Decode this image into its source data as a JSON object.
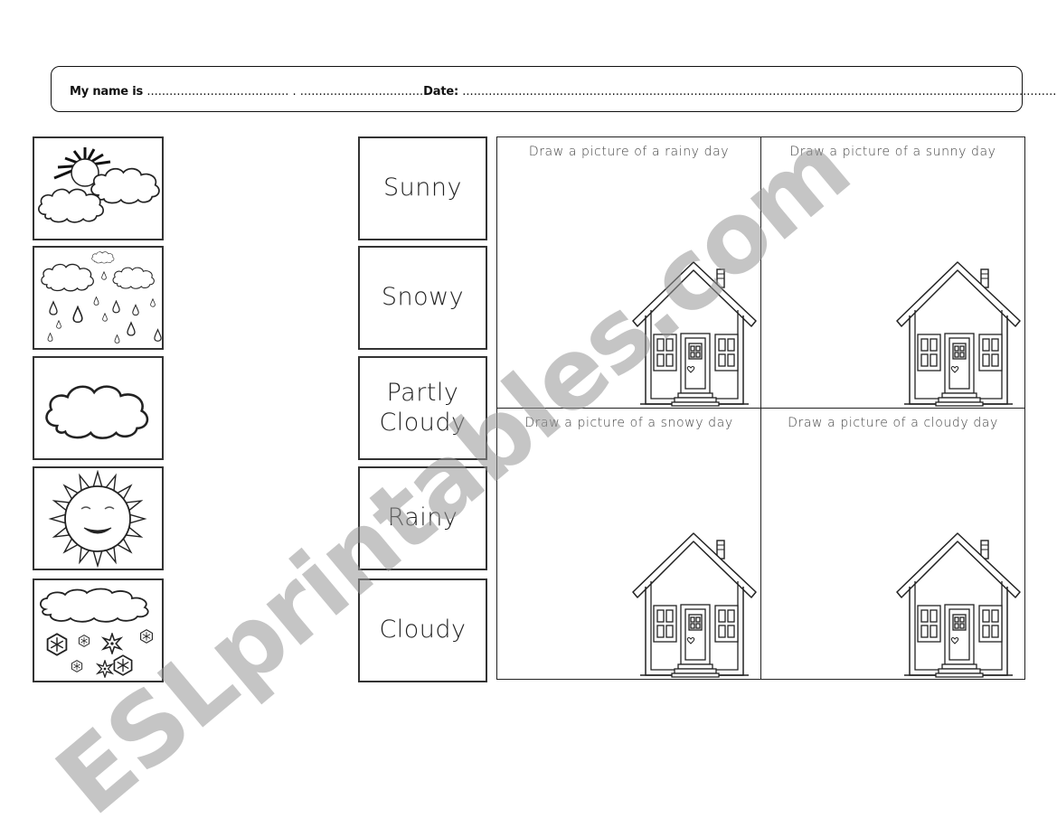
{
  "header": {
    "name_label": "My name is",
    "name_dots": "...................................... . .................................",
    "date_label": "Date",
    "date_colon": ":",
    "date_dots": "........................................................................................................................................................................................"
  },
  "pictures": [
    {
      "name": "partly-cloudy-picture",
      "icon": "sun-behind-clouds-icon"
    },
    {
      "name": "rainy-picture",
      "icon": "rain-clouds-icon"
    },
    {
      "name": "cloudy-picture",
      "icon": "cloud-icon"
    },
    {
      "name": "sunny-picture",
      "icon": "smiling-sun-icon"
    },
    {
      "name": "snowy-picture",
      "icon": "snow-cloud-icon"
    }
  ],
  "words": [
    {
      "label": "Sunny"
    },
    {
      "label": "Snowy"
    },
    {
      "label": "Partly Cloudy"
    },
    {
      "label": "Rainy"
    },
    {
      "label": "Cloudy"
    }
  ],
  "drawing_cells": [
    {
      "title": "Draw a picture of a rainy day"
    },
    {
      "title": "Draw a picture of a sunny day"
    },
    {
      "title": "Draw a picture of a snowy day"
    },
    {
      "title": "Draw a picture of a cloudy day"
    }
  ],
  "watermark": "ESLprintables.com"
}
